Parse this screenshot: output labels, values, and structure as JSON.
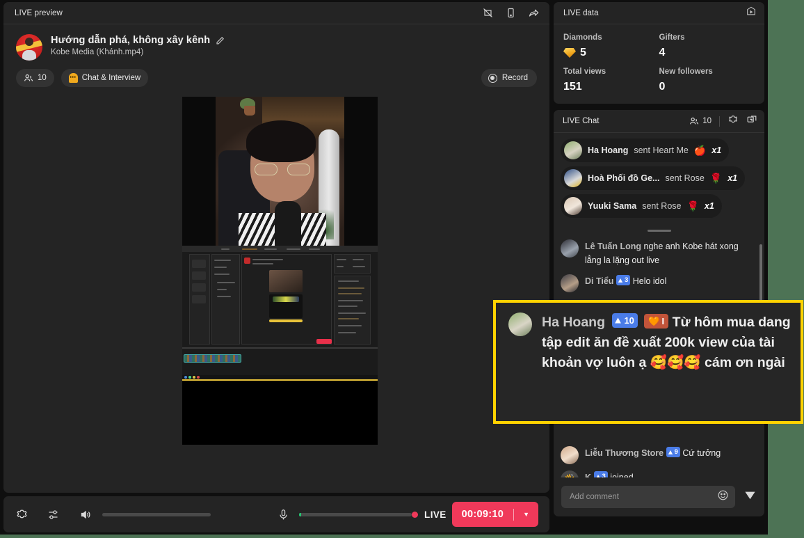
{
  "theme": {
    "accent_red": "#f0395a",
    "highlight_border": "#ffd200",
    "badge_blue": "#4a7ce8",
    "desktop_green": "#4d7355"
  },
  "preview": {
    "header_title": "LIVE preview",
    "icons": [
      {
        "name": "no-crop-icon"
      },
      {
        "name": "mobile-icon"
      },
      {
        "name": "share-icon"
      }
    ],
    "channel": {
      "title": "Hướng dẫn phá, không xây kênh",
      "subtitle": "Kobe Media  (Khánh.mp4)",
      "edit_icon": "pencil-icon"
    },
    "viewer_pill": {
      "count": "10",
      "icon": "viewers-icon"
    },
    "mode_pill": {
      "label": "Chat & Interview",
      "icon": "chat-interview-icon"
    },
    "record_button": {
      "label": "Record",
      "icon": "record-icon"
    }
  },
  "controls": {
    "settings_icon": "gear-icon",
    "mixer_icon": "sliders-icon",
    "volume_icon": "speaker-icon",
    "mic_icon": "microphone-icon",
    "live_label": "LIVE",
    "timer": "00:09:10",
    "caret": "▼"
  },
  "live_data": {
    "header_title": "LIVE data",
    "header_icon": "cast-icon",
    "stats": [
      {
        "label": "Diamonds",
        "value": "5",
        "icon": "diamond-icon"
      },
      {
        "label": "Gifters",
        "value": "4",
        "icon": ""
      },
      {
        "label": "Total views",
        "value": "151",
        "icon": ""
      },
      {
        "label": "New followers",
        "value": "0",
        "icon": ""
      }
    ]
  },
  "live_chat": {
    "header_title": "LIVE Chat",
    "viewers": "10",
    "viewers_icon": "viewers-icon",
    "settings_icon": "gear-icon",
    "popout_icon": "popout-icon",
    "gifts": [
      {
        "avatar": "a1",
        "name": "Ha Hoang",
        "action": "sent Heart Me",
        "gift_emoji": "🍎",
        "multiplier": "x1"
      },
      {
        "avatar": "a2",
        "name": "Hoà Phối đồ Ge...",
        "action": "sent Rose",
        "gift_emoji": "🌹",
        "multiplier": "x1"
      },
      {
        "avatar": "a3",
        "name": "Yuuki Sama",
        "action": "sent Rose",
        "gift_emoji": "🌹",
        "multiplier": "x1"
      }
    ],
    "messages": [
      {
        "avatar": "a4",
        "name": "Lê Tuấn Long",
        "level": "",
        "text": "nghe anh Kobe hát xong lẳng la lặng out live"
      },
      {
        "avatar": "a5",
        "name": "Di Tiểu",
        "level": "3",
        "text": "Helo idol"
      },
      {
        "avatar": "a6",
        "name": "Liễu Thương Store",
        "level": "9",
        "text": "Cứ tưởng"
      },
      {
        "avatar": "a7",
        "name": "K",
        "level": "3",
        "text": "joined"
      }
    ],
    "composer": {
      "placeholder": "Add comment",
      "emoji_icon": "emoji-icon",
      "send_icon": "send-icon"
    }
  },
  "highlight": {
    "name": "Ha Hoang",
    "level": "10",
    "badge_text": "I",
    "badge_emoji": "🧡",
    "text": "Từ hôm mua dang tập edit ăn đề xuất 200k view của tài khoản vợ luôn ạ 🥰🥰🥰 cám ơn ngài"
  }
}
